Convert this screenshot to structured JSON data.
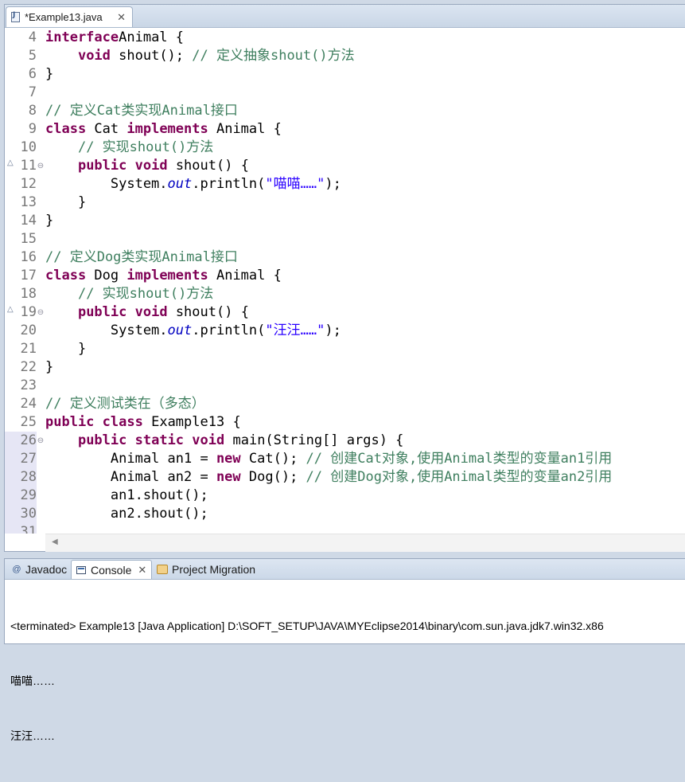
{
  "editor": {
    "tab_title": "*Example13.java",
    "tab_close": "✕",
    "lines": [
      {
        "num": "4",
        "tokens": [
          [
            "kw",
            "interface"
          ],
          [
            "",
            "Animal {"
          ]
        ]
      },
      {
        "num": "5",
        "tokens": [
          [
            "",
            "    "
          ],
          [
            "kw",
            "void"
          ],
          [
            "",
            " shout(); "
          ],
          [
            "cm",
            "// 定义抽象shout()方法"
          ]
        ]
      },
      {
        "num": "6",
        "tokens": [
          [
            "",
            "}"
          ]
        ]
      },
      {
        "num": "7",
        "tokens": []
      },
      {
        "num": "8",
        "tokens": [
          [
            "cm",
            "// 定义Cat类实现Animal接口"
          ]
        ]
      },
      {
        "num": "9",
        "tokens": [
          [
            "kw",
            "class"
          ],
          [
            "",
            " Cat "
          ],
          [
            "kw",
            "implements"
          ],
          [
            "",
            " Animal {"
          ]
        ]
      },
      {
        "num": "10",
        "tokens": [
          [
            "",
            "    "
          ],
          [
            "cm",
            "// 实现shout()方法"
          ]
        ]
      },
      {
        "num": "11",
        "tokens": [
          [
            "",
            "    "
          ],
          [
            "kw",
            "public"
          ],
          [
            "",
            " "
          ],
          [
            "kw",
            "void"
          ],
          [
            "",
            " shout() {"
          ]
        ],
        "fold": "⊖",
        "override": true
      },
      {
        "num": "12",
        "tokens": [
          [
            "",
            "        System."
          ],
          [
            "fd",
            "out"
          ],
          [
            "",
            ".println("
          ],
          [
            "st",
            "\"喵喵……\""
          ],
          [
            "",
            ");"
          ]
        ]
      },
      {
        "num": "13",
        "tokens": [
          [
            "",
            "    }"
          ]
        ]
      },
      {
        "num": "14",
        "tokens": [
          [
            "",
            "}"
          ]
        ]
      },
      {
        "num": "15",
        "tokens": []
      },
      {
        "num": "16",
        "tokens": [
          [
            "cm",
            "// 定义Dog类实现Animal接口"
          ]
        ]
      },
      {
        "num": "17",
        "tokens": [
          [
            "kw",
            "class"
          ],
          [
            "",
            " Dog "
          ],
          [
            "kw",
            "implements"
          ],
          [
            "",
            " Animal {"
          ]
        ]
      },
      {
        "num": "18",
        "tokens": [
          [
            "",
            "    "
          ],
          [
            "cm",
            "// 实现shout()方法"
          ]
        ]
      },
      {
        "num": "19",
        "tokens": [
          [
            "",
            "    "
          ],
          [
            "kw",
            "public"
          ],
          [
            "",
            " "
          ],
          [
            "kw",
            "void"
          ],
          [
            "",
            " shout() {"
          ]
        ],
        "fold": "⊖",
        "override": true
      },
      {
        "num": "20",
        "tokens": [
          [
            "",
            "        System."
          ],
          [
            "fd",
            "out"
          ],
          [
            "",
            ".println("
          ],
          [
            "st",
            "\"汪汪……\""
          ],
          [
            "",
            ");"
          ]
        ]
      },
      {
        "num": "21",
        "tokens": [
          [
            "",
            "    }"
          ]
        ]
      },
      {
        "num": "22",
        "tokens": [
          [
            "",
            "}"
          ]
        ]
      },
      {
        "num": "23",
        "tokens": []
      },
      {
        "num": "24",
        "tokens": [
          [
            "cm",
            "// 定义测试类在（多态）"
          ]
        ]
      },
      {
        "num": "25",
        "tokens": [
          [
            "kw",
            "public"
          ],
          [
            "",
            " "
          ],
          [
            "kw",
            "class"
          ],
          [
            "",
            " Example13 {"
          ]
        ]
      },
      {
        "num": "26",
        "tokens": [
          [
            "",
            "    "
          ],
          [
            "kw",
            "public"
          ],
          [
            "",
            " "
          ],
          [
            "kw",
            "static"
          ],
          [
            "",
            " "
          ],
          [
            "kw",
            "void"
          ],
          [
            "",
            " main(String[] args) {"
          ]
        ],
        "fold": "⊖",
        "hl": true
      },
      {
        "num": "27",
        "tokens": [
          [
            "",
            "        Animal an1 = "
          ],
          [
            "kw",
            "new"
          ],
          [
            "",
            " Cat(); "
          ],
          [
            "cm",
            "// 创建Cat对象,使用Animal类型的变量an1引用"
          ]
        ],
        "hl": true
      },
      {
        "num": "28",
        "tokens": [
          [
            "",
            "        Animal an2 = "
          ],
          [
            "kw",
            "new"
          ],
          [
            "",
            " Dog(); "
          ],
          [
            "cm",
            "// 创建Dog对象,使用Animal类型的变量an2引用"
          ]
        ],
        "hl": true
      },
      {
        "num": "29",
        "tokens": [
          [
            "",
            "        an1.shout();"
          ]
        ],
        "hl": true
      },
      {
        "num": "30",
        "tokens": [
          [
            "",
            "        an2.shout();"
          ]
        ],
        "hl": true
      },
      {
        "num": "31",
        "tokens": [],
        "hl": true
      }
    ]
  },
  "views": {
    "tabs": [
      {
        "label": "Javadoc",
        "icon": "@"
      },
      {
        "label": "Console",
        "close": "✕"
      },
      {
        "label": "Project Migration"
      }
    ]
  },
  "console": {
    "status": "<terminated> Example13 [Java Application] D:\\SOFT_SETUP\\JAVA\\MYEclipse2014\\binary\\com.sun.java.jdk7.win32.x86",
    "output": [
      "喵喵……",
      "汪汪……"
    ]
  }
}
